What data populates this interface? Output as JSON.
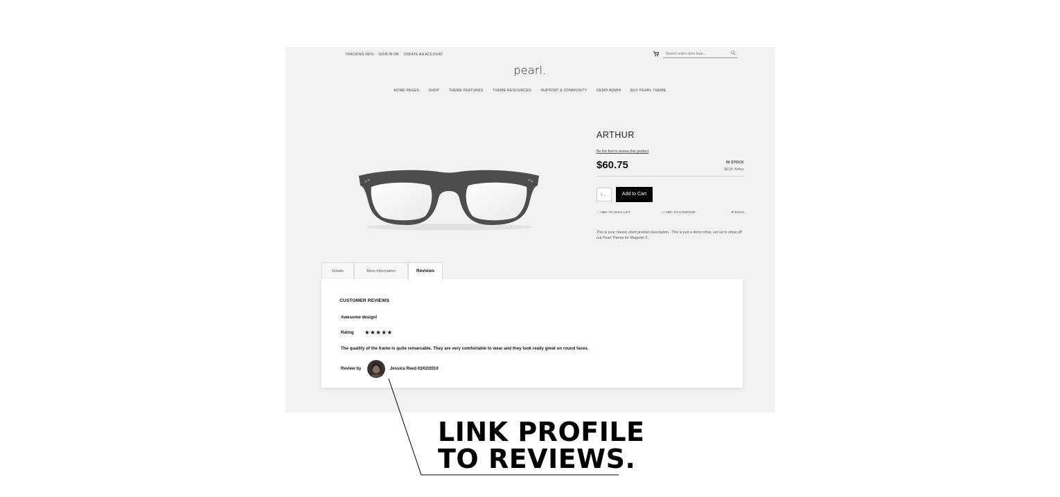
{
  "header": {
    "top_links": [
      "TRACKING INFO",
      "SIGN IN OR",
      "CREATE AN ACCOUNT"
    ],
    "search_placeholder": "Search entire store here...",
    "logo": "pearl.",
    "nav": [
      "HOME PAGES",
      "SHOP",
      "THEME FEATURES",
      "THEME RESOURCES",
      "SUPPORT & COMMUNITY",
      "DEMO ADMIN",
      "BUY PEARL THEME"
    ]
  },
  "product": {
    "title": "ARTHUR",
    "review_link": "Be the first to review this product",
    "price": "$60.75",
    "stock": "IN STOCK",
    "sku": "SKU#:  Arthur",
    "qty": "1",
    "add_to_cart": "Add to Cart",
    "actions": [
      "ADD TO WISH LIST",
      "ADD TO COMPARE",
      "EMAIL"
    ],
    "description": "This is your classic short product description . This is just a demo shop, set up to show off our Pearl Theme for Magento 2."
  },
  "tabs": [
    "Details",
    "More Information",
    "Reviews"
  ],
  "reviews": {
    "heading": "CUSTOMER REVIEWS",
    "title": "Awesome design!",
    "rating_label": "Rating",
    "stars": "★★★★★",
    "rating_value": 5,
    "rating_max": 5,
    "text": "The quallity of the frame is quite remarcable. They are very comfortable to wear and they look really great on round faces.",
    "review_by_label": "Review by",
    "author_date": "Jessica Reed 03/02/2019"
  },
  "callout": {
    "line1": "LINK PROFILE",
    "line2": "TO REVIEWS."
  },
  "icons": {
    "cart": "cart-icon",
    "search": "search-icon",
    "wishlist": "heart-icon",
    "compare": "compare-icon",
    "email": "envelope-icon"
  }
}
